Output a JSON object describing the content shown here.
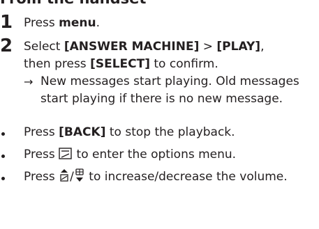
{
  "section": {
    "heading": "From the handset"
  },
  "steps": [
    {
      "number": "1",
      "parts": [
        "Press ",
        "menu",
        "."
      ]
    },
    {
      "number": "2",
      "parts": [
        "Select ",
        "[ANSWER MACHINE]",
        " > ",
        "[PLAY]",
        ",",
        "then press ",
        "[SELECT]",
        " to confirm."
      ],
      "result": "New messages start playing. Old messages start playing if there is no new message."
    }
  ],
  "bullets": [
    {
      "before": "Press ",
      "key": "[BACK]",
      "after": " to stop the playback."
    },
    {
      "before": "Press ",
      "icon": "options-softkey-icon",
      "after": " to enter the options menu."
    },
    {
      "before": "Press ",
      "icon": "volume-up-down-icons",
      "after": " to increase/decrease the volume."
    }
  ],
  "icons": {
    "result_arrow": "→"
  }
}
